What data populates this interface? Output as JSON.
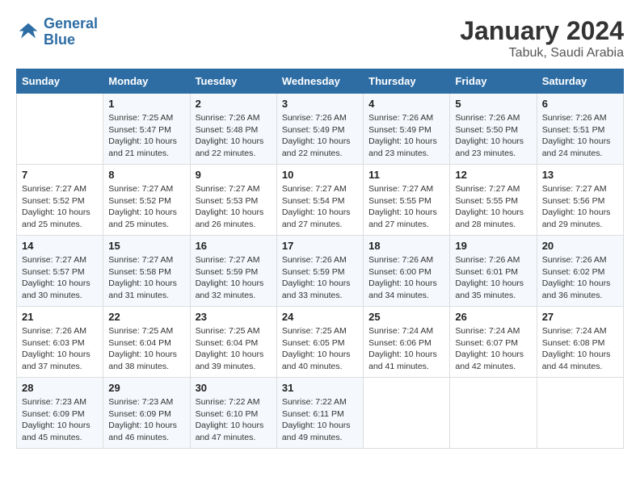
{
  "logo": {
    "line1": "General",
    "line2": "Blue"
  },
  "title": "January 2024",
  "location": "Tabuk, Saudi Arabia",
  "weekdays": [
    "Sunday",
    "Monday",
    "Tuesday",
    "Wednesday",
    "Thursday",
    "Friday",
    "Saturday"
  ],
  "weeks": [
    [
      {
        "day": "",
        "sunrise": "",
        "sunset": "",
        "daylight": ""
      },
      {
        "day": "1",
        "sunrise": "Sunrise: 7:25 AM",
        "sunset": "Sunset: 5:47 PM",
        "daylight": "Daylight: 10 hours and 21 minutes."
      },
      {
        "day": "2",
        "sunrise": "Sunrise: 7:26 AM",
        "sunset": "Sunset: 5:48 PM",
        "daylight": "Daylight: 10 hours and 22 minutes."
      },
      {
        "day": "3",
        "sunrise": "Sunrise: 7:26 AM",
        "sunset": "Sunset: 5:49 PM",
        "daylight": "Daylight: 10 hours and 22 minutes."
      },
      {
        "day": "4",
        "sunrise": "Sunrise: 7:26 AM",
        "sunset": "Sunset: 5:49 PM",
        "daylight": "Daylight: 10 hours and 23 minutes."
      },
      {
        "day": "5",
        "sunrise": "Sunrise: 7:26 AM",
        "sunset": "Sunset: 5:50 PM",
        "daylight": "Daylight: 10 hours and 23 minutes."
      },
      {
        "day": "6",
        "sunrise": "Sunrise: 7:26 AM",
        "sunset": "Sunset: 5:51 PM",
        "daylight": "Daylight: 10 hours and 24 minutes."
      }
    ],
    [
      {
        "day": "7",
        "sunrise": "Sunrise: 7:27 AM",
        "sunset": "Sunset: 5:52 PM",
        "daylight": "Daylight: 10 hours and 25 minutes."
      },
      {
        "day": "8",
        "sunrise": "Sunrise: 7:27 AM",
        "sunset": "Sunset: 5:52 PM",
        "daylight": "Daylight: 10 hours and 25 minutes."
      },
      {
        "day": "9",
        "sunrise": "Sunrise: 7:27 AM",
        "sunset": "Sunset: 5:53 PM",
        "daylight": "Daylight: 10 hours and 26 minutes."
      },
      {
        "day": "10",
        "sunrise": "Sunrise: 7:27 AM",
        "sunset": "Sunset: 5:54 PM",
        "daylight": "Daylight: 10 hours and 27 minutes."
      },
      {
        "day": "11",
        "sunrise": "Sunrise: 7:27 AM",
        "sunset": "Sunset: 5:55 PM",
        "daylight": "Daylight: 10 hours and 27 minutes."
      },
      {
        "day": "12",
        "sunrise": "Sunrise: 7:27 AM",
        "sunset": "Sunset: 5:55 PM",
        "daylight": "Daylight: 10 hours and 28 minutes."
      },
      {
        "day": "13",
        "sunrise": "Sunrise: 7:27 AM",
        "sunset": "Sunset: 5:56 PM",
        "daylight": "Daylight: 10 hours and 29 minutes."
      }
    ],
    [
      {
        "day": "14",
        "sunrise": "Sunrise: 7:27 AM",
        "sunset": "Sunset: 5:57 PM",
        "daylight": "Daylight: 10 hours and 30 minutes."
      },
      {
        "day": "15",
        "sunrise": "Sunrise: 7:27 AM",
        "sunset": "Sunset: 5:58 PM",
        "daylight": "Daylight: 10 hours and 31 minutes."
      },
      {
        "day": "16",
        "sunrise": "Sunrise: 7:27 AM",
        "sunset": "Sunset: 5:59 PM",
        "daylight": "Daylight: 10 hours and 32 minutes."
      },
      {
        "day": "17",
        "sunrise": "Sunrise: 7:26 AM",
        "sunset": "Sunset: 5:59 PM",
        "daylight": "Daylight: 10 hours and 33 minutes."
      },
      {
        "day": "18",
        "sunrise": "Sunrise: 7:26 AM",
        "sunset": "Sunset: 6:00 PM",
        "daylight": "Daylight: 10 hours and 34 minutes."
      },
      {
        "day": "19",
        "sunrise": "Sunrise: 7:26 AM",
        "sunset": "Sunset: 6:01 PM",
        "daylight": "Daylight: 10 hours and 35 minutes."
      },
      {
        "day": "20",
        "sunrise": "Sunrise: 7:26 AM",
        "sunset": "Sunset: 6:02 PM",
        "daylight": "Daylight: 10 hours and 36 minutes."
      }
    ],
    [
      {
        "day": "21",
        "sunrise": "Sunrise: 7:26 AM",
        "sunset": "Sunset: 6:03 PM",
        "daylight": "Daylight: 10 hours and 37 minutes."
      },
      {
        "day": "22",
        "sunrise": "Sunrise: 7:25 AM",
        "sunset": "Sunset: 6:04 PM",
        "daylight": "Daylight: 10 hours and 38 minutes."
      },
      {
        "day": "23",
        "sunrise": "Sunrise: 7:25 AM",
        "sunset": "Sunset: 6:04 PM",
        "daylight": "Daylight: 10 hours and 39 minutes."
      },
      {
        "day": "24",
        "sunrise": "Sunrise: 7:25 AM",
        "sunset": "Sunset: 6:05 PM",
        "daylight": "Daylight: 10 hours and 40 minutes."
      },
      {
        "day": "25",
        "sunrise": "Sunrise: 7:24 AM",
        "sunset": "Sunset: 6:06 PM",
        "daylight": "Daylight: 10 hours and 41 minutes."
      },
      {
        "day": "26",
        "sunrise": "Sunrise: 7:24 AM",
        "sunset": "Sunset: 6:07 PM",
        "daylight": "Daylight: 10 hours and 42 minutes."
      },
      {
        "day": "27",
        "sunrise": "Sunrise: 7:24 AM",
        "sunset": "Sunset: 6:08 PM",
        "daylight": "Daylight: 10 hours and 44 minutes."
      }
    ],
    [
      {
        "day": "28",
        "sunrise": "Sunrise: 7:23 AM",
        "sunset": "Sunset: 6:09 PM",
        "daylight": "Daylight: 10 hours and 45 minutes."
      },
      {
        "day": "29",
        "sunrise": "Sunrise: 7:23 AM",
        "sunset": "Sunset: 6:09 PM",
        "daylight": "Daylight: 10 hours and 46 minutes."
      },
      {
        "day": "30",
        "sunrise": "Sunrise: 7:22 AM",
        "sunset": "Sunset: 6:10 PM",
        "daylight": "Daylight: 10 hours and 47 minutes."
      },
      {
        "day": "31",
        "sunrise": "Sunrise: 7:22 AM",
        "sunset": "Sunset: 6:11 PM",
        "daylight": "Daylight: 10 hours and 49 minutes."
      },
      {
        "day": "",
        "sunrise": "",
        "sunset": "",
        "daylight": ""
      },
      {
        "day": "",
        "sunrise": "",
        "sunset": "",
        "daylight": ""
      },
      {
        "day": "",
        "sunrise": "",
        "sunset": "",
        "daylight": ""
      }
    ]
  ]
}
